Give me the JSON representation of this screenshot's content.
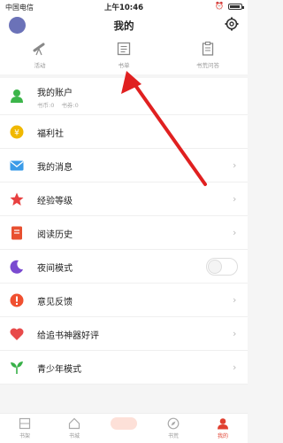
{
  "status_bar": {
    "carrier": "中国电信",
    "time": "上午10:46"
  },
  "header": {
    "title": "我的"
  },
  "tools": [
    {
      "label": "活动"
    },
    {
      "label": "书单"
    },
    {
      "label": "书荒问答"
    }
  ],
  "account": {
    "title": "我的账户",
    "coins": "书币:0",
    "vouchers": "书券:0"
  },
  "menu": [
    {
      "label": "福利社",
      "color": "#f0b800"
    },
    {
      "label": "我的消息",
      "color": "#3a9be8"
    },
    {
      "label": "经验等级",
      "color": "#e84040"
    },
    {
      "label": "阅读历史",
      "color": "#e85030"
    },
    {
      "label": "夜间模式",
      "color": "#7a4ad0"
    },
    {
      "label": "意见反馈",
      "color": "#f05030"
    },
    {
      "label": "给追书神器好评",
      "color": "#e84a4a"
    },
    {
      "label": "青少年模式",
      "color": "#38b048"
    }
  ],
  "tabbar": [
    {
      "label": "书架"
    },
    {
      "label": "书城"
    },
    {
      "label": ""
    },
    {
      "label": "书荒"
    },
    {
      "label": "我的"
    }
  ],
  "colors": {
    "accent": "#e04030",
    "arrow": "#e02020",
    "account_icon": "#3cb54a"
  }
}
